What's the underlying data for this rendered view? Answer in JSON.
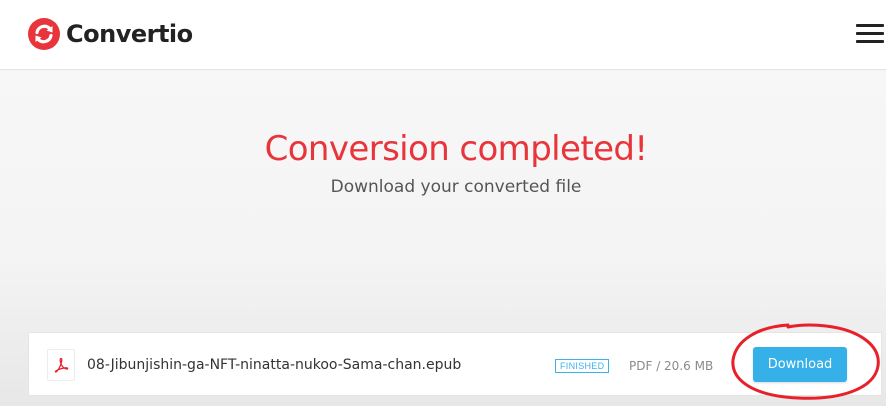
{
  "header": {
    "logo_text": "Convertio",
    "logo_icon": "convertio-logo-icon",
    "menu_icon": "hamburger-menu-icon"
  },
  "hero": {
    "title": "Conversion completed!",
    "subtitle": "Download your converted file"
  },
  "file": {
    "name": "08-Jibunjishin-ga-NFT-ninatta-nukoo-Sama-chan.epub",
    "icon": "pdf-file-icon",
    "status": "FINISHED",
    "meta": "PDF / 20.6 MB",
    "download_label": "Download"
  },
  "colors": {
    "brand_red": "#e8353b",
    "accent_blue": "#36b0e8",
    "annotation_red": "#e8202a"
  }
}
